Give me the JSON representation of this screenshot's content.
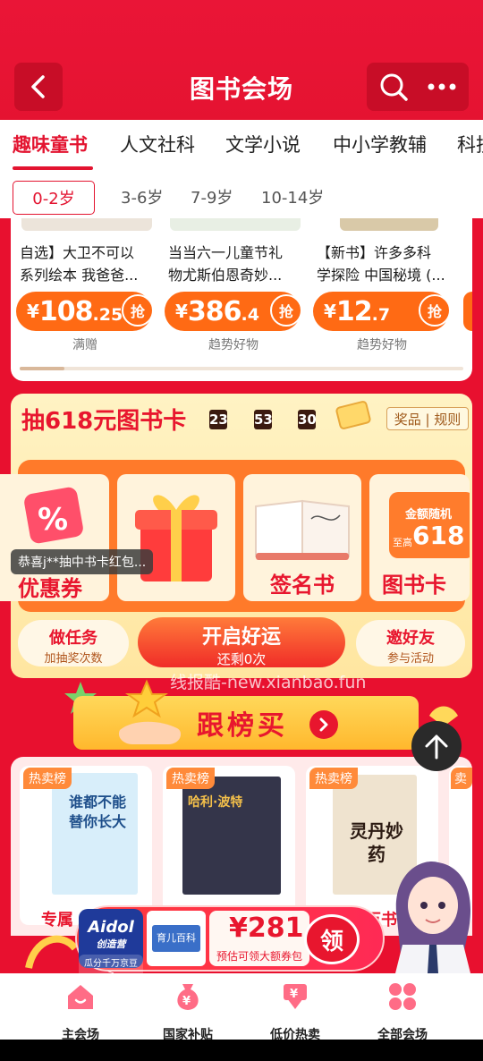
{
  "header": {
    "title": "图书会场",
    "back_icon": "chevron-left-icon",
    "search_icon": "search-icon",
    "more_icon": "more-dots-icon"
  },
  "category_tabs": [
    "趣味童书",
    "人文社科",
    "文学小说",
    "中小学教辅",
    "科技"
  ],
  "age_tabs": [
    "0-2岁",
    "3-6岁",
    "7-9岁",
    "10-14岁"
  ],
  "products": [
    {
      "title_line1": "自选】大卫不可以",
      "title_line2": "系列绘本 我爸爸...",
      "yen": "¥",
      "price_int": "108",
      "price_dec": ".25",
      "grab": "抢",
      "tag": "满赠"
    },
    {
      "title_line1": "当当六一儿童节礼",
      "title_line2": "物尤斯伯恩奇妙...",
      "yen": "¥",
      "price_int": "386",
      "price_dec": ".4",
      "grab": "抢",
      "tag": "趋势好物"
    },
    {
      "title_line1": "【新书】许多多科",
      "title_line2": "学探险 中国秘境 (...",
      "yen": "¥",
      "price_int": "12",
      "price_dec": ".7",
      "grab": "抢",
      "tag": "趋势好物"
    }
  ],
  "lottery": {
    "title": "抽618元图书卡",
    "countdown": [
      "23",
      "53",
      "30"
    ],
    "rules": "奖品 | 规则",
    "prizes": [
      "优惠券",
      "",
      "签名书",
      "图书卡"
    ],
    "gift_card_top": "金额随机",
    "gift_card_amount": "618",
    "gift_card_prefix": "至高",
    "toast": "恭喜j**抽中书卡红包...",
    "task_btn": {
      "title": "做任务",
      "sub": "加抽奖次数"
    },
    "luck_btn": {
      "title": "开启好运",
      "sub": "还剩0次"
    },
    "invite_btn": {
      "title": "邀好友",
      "sub": "参与活动"
    }
  },
  "watermark": "线报酷-new.xianbao.fun",
  "follow_banner": "跟榜买",
  "hot_list": {
    "badge": "热卖榜",
    "book1_cover": "谁都不能替你长大",
    "book2_cover": "哈利·波特",
    "book3_cover": "灵丹妙药",
    "label_left": "专属",
    "label_right": "万书节"
  },
  "promo": {
    "aidol": "Aidol",
    "aidol_sub": "创造营",
    "aidol_tag": "瓜分千万京豆>",
    "book_title": "育儿百科",
    "price": "¥281",
    "sub": "预估可领大额券包",
    "ling": "领"
  },
  "bottom_nav": [
    {
      "label": "主会场",
      "icon": "home-icon"
    },
    {
      "label": "国家补贴",
      "icon": "subsidy-bag-icon"
    },
    {
      "label": "低价热卖",
      "icon": "discount-icon"
    },
    {
      "label": "全部会场",
      "icon": "grid-apps-icon"
    }
  ],
  "colors": {
    "brand_red": "#e8162e",
    "accent_orange": "#ff6a14",
    "lottery_bg": "#fff3c4"
  }
}
